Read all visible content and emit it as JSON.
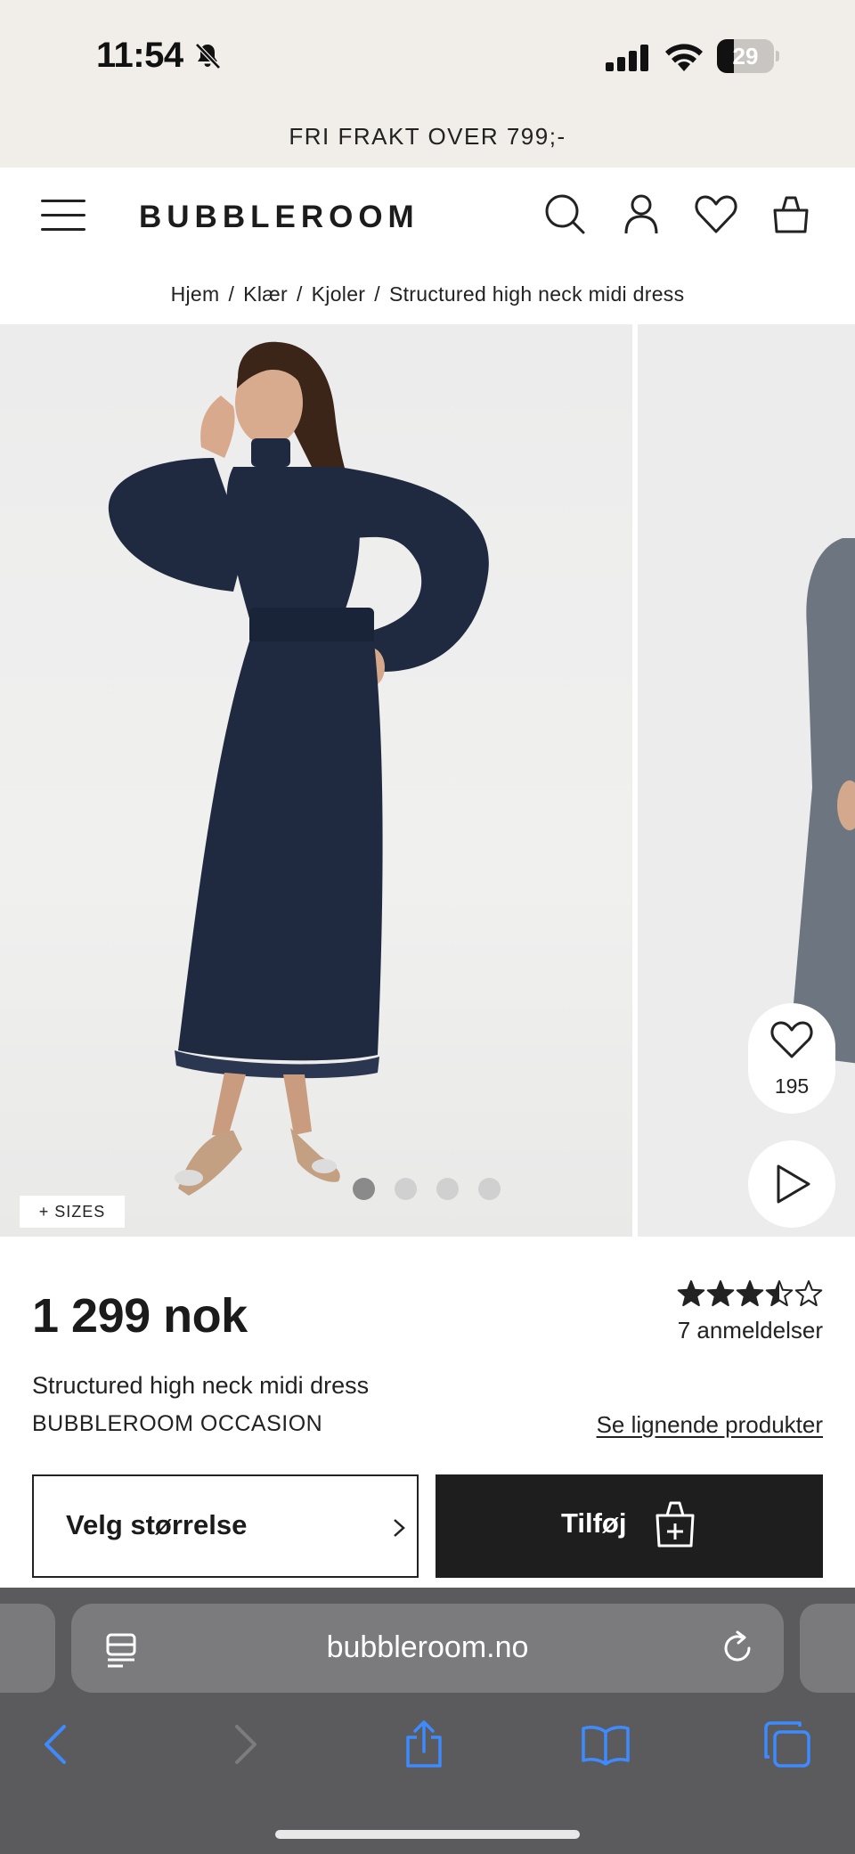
{
  "status_bar": {
    "time": "11:54",
    "battery_level": "29",
    "battery_fraction": 0.29
  },
  "promo": {
    "text": "FRI FRAKT OVER 799;-"
  },
  "header": {
    "logo": "BUBBLEROOM",
    "icons": [
      "menu-icon",
      "search-icon",
      "account-icon",
      "wishlist-heart-icon",
      "shopping-bag-icon"
    ]
  },
  "breadcrumb": {
    "items": [
      "Hjem",
      "Klær",
      "Kjoler",
      "Structured high neck midi dress"
    ],
    "separator": "/"
  },
  "gallery": {
    "sizes_tag": "+ SIZES",
    "slide_count": 4,
    "active_slide": 1,
    "favorite_count": "195",
    "dress_color": "#1f2a40",
    "slide2_dress_color": "#6c7580"
  },
  "product": {
    "price": "1 299 nok",
    "rating": 3.5,
    "rating_max": 5,
    "reviews": "7 anmeldelser",
    "name": "Structured high neck midi dress",
    "brand": "BUBBLEROOM OCCASION",
    "similar_link": "Se lignende produkter",
    "size_button": "Velg størrelse",
    "add_button": "Tilføj"
  },
  "browser": {
    "url": "bubbleroom.no",
    "toolbar": [
      "back-icon",
      "forward-icon",
      "share-icon",
      "bookmarks-icon",
      "tabs-icon"
    ],
    "accent": "#3d8bff"
  }
}
